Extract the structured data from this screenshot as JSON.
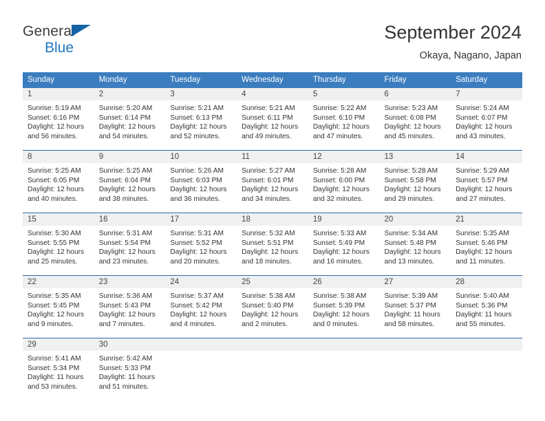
{
  "brand": {
    "line1": "General",
    "line2": "Blue",
    "flag_color": "#1464a5",
    "line2_color": "#1f76c2"
  },
  "header": {
    "title": "September 2024",
    "subtitle": "Okaya, Nagano, Japan"
  },
  "theme": {
    "header_blue": "#3b7dbf",
    "row_divider_blue": "#2e6da4",
    "daynum_band": "#f0f0f0",
    "text": "#333333"
  },
  "weekdays": [
    "Sunday",
    "Monday",
    "Tuesday",
    "Wednesday",
    "Thursday",
    "Friday",
    "Saturday"
  ],
  "labels": {
    "sunrise_prefix": "Sunrise:",
    "sunset_prefix": "Sunset:",
    "daylight_prefix": "Daylight:"
  },
  "weeks": [
    [
      {
        "day": "1",
        "sunrise": "Sunrise: 5:19 AM",
        "sunset": "Sunset: 6:16 PM",
        "daylight1": "Daylight: 12 hours",
        "daylight2": "and 56 minutes."
      },
      {
        "day": "2",
        "sunrise": "Sunrise: 5:20 AM",
        "sunset": "Sunset: 6:14 PM",
        "daylight1": "Daylight: 12 hours",
        "daylight2": "and 54 minutes."
      },
      {
        "day": "3",
        "sunrise": "Sunrise: 5:21 AM",
        "sunset": "Sunset: 6:13 PM",
        "daylight1": "Daylight: 12 hours",
        "daylight2": "and 52 minutes."
      },
      {
        "day": "4",
        "sunrise": "Sunrise: 5:21 AM",
        "sunset": "Sunset: 6:11 PM",
        "daylight1": "Daylight: 12 hours",
        "daylight2": "and 49 minutes."
      },
      {
        "day": "5",
        "sunrise": "Sunrise: 5:22 AM",
        "sunset": "Sunset: 6:10 PM",
        "daylight1": "Daylight: 12 hours",
        "daylight2": "and 47 minutes."
      },
      {
        "day": "6",
        "sunrise": "Sunrise: 5:23 AM",
        "sunset": "Sunset: 6:08 PM",
        "daylight1": "Daylight: 12 hours",
        "daylight2": "and 45 minutes."
      },
      {
        "day": "7",
        "sunrise": "Sunrise: 5:24 AM",
        "sunset": "Sunset: 6:07 PM",
        "daylight1": "Daylight: 12 hours",
        "daylight2": "and 43 minutes."
      }
    ],
    [
      {
        "day": "8",
        "sunrise": "Sunrise: 5:25 AM",
        "sunset": "Sunset: 6:05 PM",
        "daylight1": "Daylight: 12 hours",
        "daylight2": "and 40 minutes."
      },
      {
        "day": "9",
        "sunrise": "Sunrise: 5:25 AM",
        "sunset": "Sunset: 6:04 PM",
        "daylight1": "Daylight: 12 hours",
        "daylight2": "and 38 minutes."
      },
      {
        "day": "10",
        "sunrise": "Sunrise: 5:26 AM",
        "sunset": "Sunset: 6:03 PM",
        "daylight1": "Daylight: 12 hours",
        "daylight2": "and 36 minutes."
      },
      {
        "day": "11",
        "sunrise": "Sunrise: 5:27 AM",
        "sunset": "Sunset: 6:01 PM",
        "daylight1": "Daylight: 12 hours",
        "daylight2": "and 34 minutes."
      },
      {
        "day": "12",
        "sunrise": "Sunrise: 5:28 AM",
        "sunset": "Sunset: 6:00 PM",
        "daylight1": "Daylight: 12 hours",
        "daylight2": "and 32 minutes."
      },
      {
        "day": "13",
        "sunrise": "Sunrise: 5:28 AM",
        "sunset": "Sunset: 5:58 PM",
        "daylight1": "Daylight: 12 hours",
        "daylight2": "and 29 minutes."
      },
      {
        "day": "14",
        "sunrise": "Sunrise: 5:29 AM",
        "sunset": "Sunset: 5:57 PM",
        "daylight1": "Daylight: 12 hours",
        "daylight2": "and 27 minutes."
      }
    ],
    [
      {
        "day": "15",
        "sunrise": "Sunrise: 5:30 AM",
        "sunset": "Sunset: 5:55 PM",
        "daylight1": "Daylight: 12 hours",
        "daylight2": "and 25 minutes."
      },
      {
        "day": "16",
        "sunrise": "Sunrise: 5:31 AM",
        "sunset": "Sunset: 5:54 PM",
        "daylight1": "Daylight: 12 hours",
        "daylight2": "and 23 minutes."
      },
      {
        "day": "17",
        "sunrise": "Sunrise: 5:31 AM",
        "sunset": "Sunset: 5:52 PM",
        "daylight1": "Daylight: 12 hours",
        "daylight2": "and 20 minutes."
      },
      {
        "day": "18",
        "sunrise": "Sunrise: 5:32 AM",
        "sunset": "Sunset: 5:51 PM",
        "daylight1": "Daylight: 12 hours",
        "daylight2": "and 18 minutes."
      },
      {
        "day": "19",
        "sunrise": "Sunrise: 5:33 AM",
        "sunset": "Sunset: 5:49 PM",
        "daylight1": "Daylight: 12 hours",
        "daylight2": "and 16 minutes."
      },
      {
        "day": "20",
        "sunrise": "Sunrise: 5:34 AM",
        "sunset": "Sunset: 5:48 PM",
        "daylight1": "Daylight: 12 hours",
        "daylight2": "and 13 minutes."
      },
      {
        "day": "21",
        "sunrise": "Sunrise: 5:35 AM",
        "sunset": "Sunset: 5:46 PM",
        "daylight1": "Daylight: 12 hours",
        "daylight2": "and 11 minutes."
      }
    ],
    [
      {
        "day": "22",
        "sunrise": "Sunrise: 5:35 AM",
        "sunset": "Sunset: 5:45 PM",
        "daylight1": "Daylight: 12 hours",
        "daylight2": "and 9 minutes."
      },
      {
        "day": "23",
        "sunrise": "Sunrise: 5:36 AM",
        "sunset": "Sunset: 5:43 PM",
        "daylight1": "Daylight: 12 hours",
        "daylight2": "and 7 minutes."
      },
      {
        "day": "24",
        "sunrise": "Sunrise: 5:37 AM",
        "sunset": "Sunset: 5:42 PM",
        "daylight1": "Daylight: 12 hours",
        "daylight2": "and 4 minutes."
      },
      {
        "day": "25",
        "sunrise": "Sunrise: 5:38 AM",
        "sunset": "Sunset: 5:40 PM",
        "daylight1": "Daylight: 12 hours",
        "daylight2": "and 2 minutes."
      },
      {
        "day": "26",
        "sunrise": "Sunrise: 5:38 AM",
        "sunset": "Sunset: 5:39 PM",
        "daylight1": "Daylight: 12 hours",
        "daylight2": "and 0 minutes."
      },
      {
        "day": "27",
        "sunrise": "Sunrise: 5:39 AM",
        "sunset": "Sunset: 5:37 PM",
        "daylight1": "Daylight: 11 hours",
        "daylight2": "and 58 minutes."
      },
      {
        "day": "28",
        "sunrise": "Sunrise: 5:40 AM",
        "sunset": "Sunset: 5:36 PM",
        "daylight1": "Daylight: 11 hours",
        "daylight2": "and 55 minutes."
      }
    ],
    [
      {
        "day": "29",
        "sunrise": "Sunrise: 5:41 AM",
        "sunset": "Sunset: 5:34 PM",
        "daylight1": "Daylight: 11 hours",
        "daylight2": "and 53 minutes."
      },
      {
        "day": "30",
        "sunrise": "Sunrise: 5:42 AM",
        "sunset": "Sunset: 5:33 PM",
        "daylight1": "Daylight: 11 hours",
        "daylight2": "and 51 minutes."
      },
      {
        "day": "",
        "sunrise": "",
        "sunset": "",
        "daylight1": "",
        "daylight2": ""
      },
      {
        "day": "",
        "sunrise": "",
        "sunset": "",
        "daylight1": "",
        "daylight2": ""
      },
      {
        "day": "",
        "sunrise": "",
        "sunset": "",
        "daylight1": "",
        "daylight2": ""
      },
      {
        "day": "",
        "sunrise": "",
        "sunset": "",
        "daylight1": "",
        "daylight2": ""
      },
      {
        "day": "",
        "sunrise": "",
        "sunset": "",
        "daylight1": "",
        "daylight2": ""
      }
    ]
  ]
}
